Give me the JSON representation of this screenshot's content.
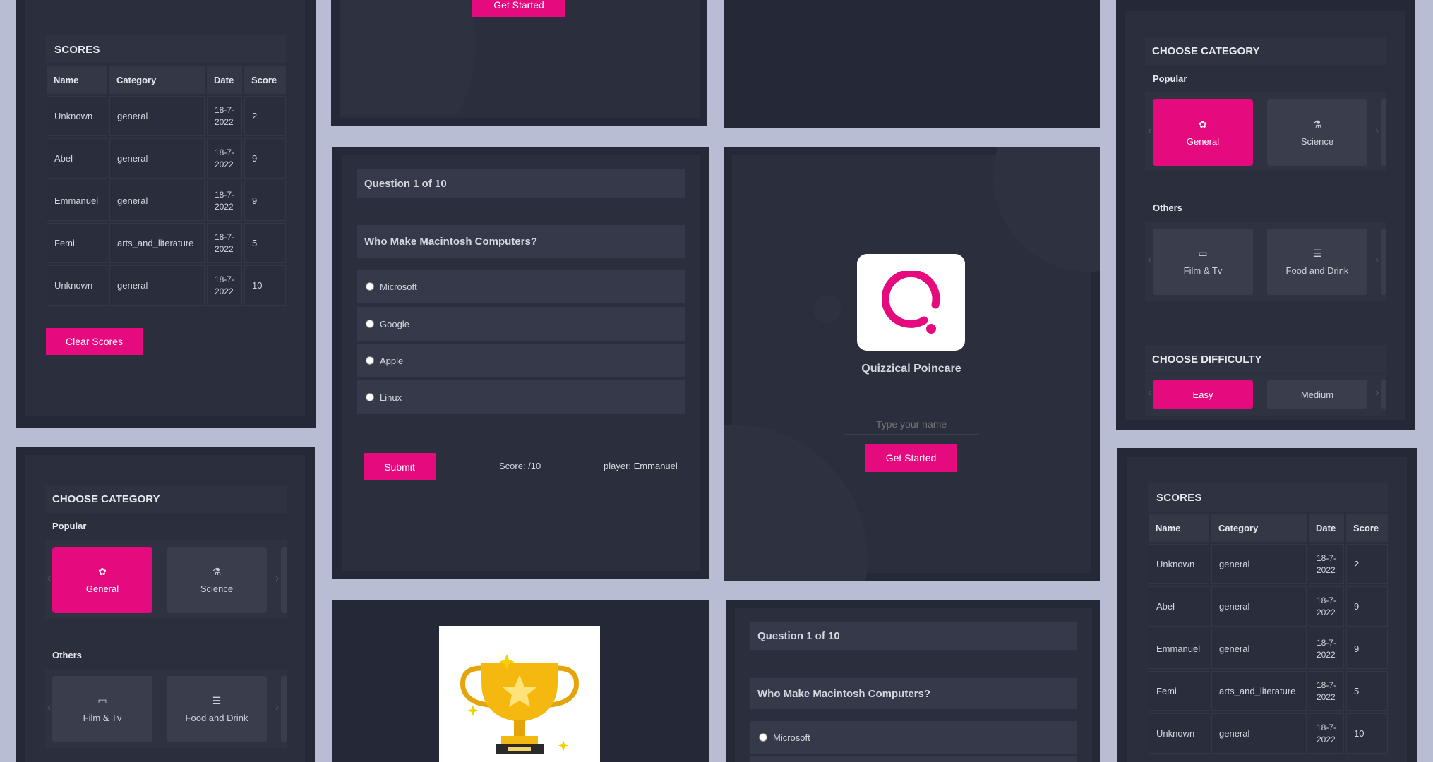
{
  "scores": {
    "title": "SCORES",
    "columns": [
      "Name",
      "Category",
      "Date",
      "Score"
    ],
    "rows": [
      {
        "name": "Unknown",
        "category": "general",
        "date": "18-7-2022",
        "score": "2"
      },
      {
        "name": "Abel",
        "category": "general",
        "date": "18-7-2022",
        "score": "9"
      },
      {
        "name": "Emmanuel",
        "category": "general",
        "date": "18-7-2022",
        "score": "9"
      },
      {
        "name": "Femi",
        "category": "arts_and_literature",
        "date": "18-7-2022",
        "score": "5"
      },
      {
        "name": "Unknown",
        "category": "general",
        "date": "18-7-2022",
        "score": "10"
      }
    ],
    "clear_label": "Clear Scores"
  },
  "top_start": {
    "label": "Get Started"
  },
  "quiz": {
    "progress": "Question 1 of 10",
    "question": "Who Make Macintosh Computers?",
    "options": [
      "Microsoft",
      "Google",
      "Apple",
      "Linux"
    ],
    "submit_label": "Submit",
    "score_text": "Score: /10",
    "player_text": "player: Emmanuel"
  },
  "welcome": {
    "app_name": "Quizzical Poincare",
    "name_placeholder": "Type your name",
    "start_label": "Get Started"
  },
  "category": {
    "title": "CHOOSE CATEGORY",
    "popular_label": "Popular",
    "others_label": "Others",
    "popular": [
      {
        "label": "General",
        "icon": "brain-icon",
        "selected": true
      },
      {
        "label": "Science",
        "icon": "microscope-icon",
        "selected": false
      }
    ],
    "others": [
      {
        "label": "Film & Tv",
        "icon": "tv-icon",
        "selected": false
      },
      {
        "label": "Food and Drink",
        "icon": "burger-icon",
        "selected": false
      }
    ],
    "difficulty_title": "CHOOSE DIFFICULTY",
    "difficulty": [
      {
        "label": "Easy",
        "selected": true
      },
      {
        "label": "Medium",
        "selected": false
      }
    ]
  },
  "colors": {
    "accent": "#e50a7e",
    "panel": "#252836",
    "background": "#b9bdd3"
  }
}
